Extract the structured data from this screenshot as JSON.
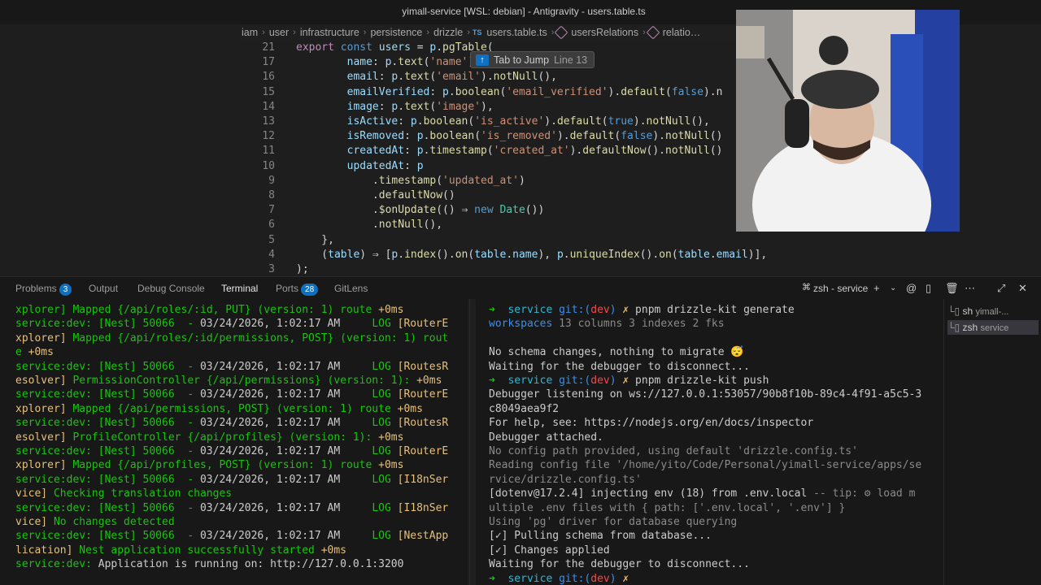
{
  "window": {
    "title": "yimall-service [WSL: debian] - Antigravity - users.table.ts"
  },
  "breadcrumb": [
    "iam",
    "user",
    "infrastructure",
    "persistence",
    "drizzle",
    "users.table.ts",
    "usersRelations",
    "relatio…"
  ],
  "breadcrumb_file_badge": "TS",
  "tooltip": {
    "text": "Tab to Jump",
    "sub": "Line 13"
  },
  "editor": {
    "lines": [
      {
        "n": "21",
        "segs": [
          [
            "kw",
            "export "
          ],
          [
            "kw2",
            "const "
          ],
          [
            "var",
            "users"
          ],
          [
            "w",
            " = "
          ],
          [
            "var",
            "p"
          ],
          [
            "w",
            "."
          ],
          [
            "fn",
            "pgTable"
          ],
          [
            "w",
            "("
          ]
        ]
      },
      {
        "n": "17",
        "segs": [
          [
            "w",
            "        "
          ],
          [
            "var",
            "name"
          ],
          [
            "w",
            ": "
          ],
          [
            "var",
            "p"
          ],
          [
            "w",
            "."
          ],
          [
            "fn",
            "text"
          ],
          [
            "w",
            "("
          ],
          [
            "str",
            "'name'"
          ],
          [
            "w",
            ")"
          ]
        ]
      },
      {
        "n": "16",
        "segs": [
          [
            "w",
            "        "
          ],
          [
            "var",
            "email"
          ],
          [
            "w",
            ": "
          ],
          [
            "var",
            "p"
          ],
          [
            "w",
            "."
          ],
          [
            "fn",
            "text"
          ],
          [
            "w",
            "("
          ],
          [
            "str",
            "'email'"
          ],
          [
            "w",
            ")."
          ],
          [
            "fn",
            "notNull"
          ],
          [
            "w",
            "(),"
          ]
        ]
      },
      {
        "n": "15",
        "segs": [
          [
            "w",
            "        "
          ],
          [
            "var",
            "emailVerified"
          ],
          [
            "w",
            ": "
          ],
          [
            "var",
            "p"
          ],
          [
            "w",
            "."
          ],
          [
            "fn",
            "boolean"
          ],
          [
            "w",
            "("
          ],
          [
            "str",
            "'email_verified'"
          ],
          [
            "w",
            ")."
          ],
          [
            "fn",
            "default"
          ],
          [
            "w",
            "("
          ],
          [
            "kw2",
            "false"
          ],
          [
            "w",
            ").n"
          ]
        ]
      },
      {
        "n": "14",
        "segs": [
          [
            "w",
            "        "
          ],
          [
            "var",
            "image"
          ],
          [
            "w",
            ": "
          ],
          [
            "var",
            "p"
          ],
          [
            "w",
            "."
          ],
          [
            "fn",
            "text"
          ],
          [
            "w",
            "("
          ],
          [
            "str",
            "'image'"
          ],
          [
            "w",
            "),"
          ]
        ]
      },
      {
        "n": "13",
        "segs": [
          [
            "w",
            "        "
          ],
          [
            "var",
            "isActive"
          ],
          [
            "w",
            ": "
          ],
          [
            "var",
            "p"
          ],
          [
            "w",
            "."
          ],
          [
            "fn",
            "boolean"
          ],
          [
            "w",
            "("
          ],
          [
            "str",
            "'is_active'"
          ],
          [
            "w",
            ")."
          ],
          [
            "fn",
            "default"
          ],
          [
            "w",
            "("
          ],
          [
            "kw2",
            "true"
          ],
          [
            "w",
            ")."
          ],
          [
            "fn",
            "notNull"
          ],
          [
            "w",
            "(),"
          ]
        ]
      },
      {
        "n": "12",
        "segs": [
          [
            "w",
            "        "
          ],
          [
            "var",
            "isRemoved"
          ],
          [
            "w",
            ": "
          ],
          [
            "var",
            "p"
          ],
          [
            "w",
            "."
          ],
          [
            "fn",
            "boolean"
          ],
          [
            "w",
            "("
          ],
          [
            "str",
            "'is_removed'"
          ],
          [
            "w",
            ")."
          ],
          [
            "fn",
            "default"
          ],
          [
            "w",
            "("
          ],
          [
            "kw2",
            "false"
          ],
          [
            "w",
            ")."
          ],
          [
            "fn",
            "notNull"
          ],
          [
            "w",
            "()"
          ]
        ]
      },
      {
        "n": "11",
        "segs": [
          [
            "w",
            "        "
          ],
          [
            "var",
            "createdAt"
          ],
          [
            "w",
            ": "
          ],
          [
            "var",
            "p"
          ],
          [
            "w",
            "."
          ],
          [
            "fn",
            "timestamp"
          ],
          [
            "w",
            "("
          ],
          [
            "str",
            "'created_at'"
          ],
          [
            "w",
            ")."
          ],
          [
            "fn",
            "defaultNow"
          ],
          [
            "w",
            "()."
          ],
          [
            "fn",
            "notNull"
          ],
          [
            "w",
            "()"
          ]
        ]
      },
      {
        "n": "10",
        "segs": [
          [
            "w",
            "        "
          ],
          [
            "var",
            "updatedAt"
          ],
          [
            "w",
            ": "
          ],
          [
            "var",
            "p"
          ]
        ]
      },
      {
        "n": "9",
        "segs": [
          [
            "w",
            "            ."
          ],
          [
            "fn",
            "timestamp"
          ],
          [
            "w",
            "("
          ],
          [
            "str",
            "'updated_at'"
          ],
          [
            "w",
            ")"
          ]
        ]
      },
      {
        "n": "8",
        "segs": [
          [
            "w",
            "            ."
          ],
          [
            "fn",
            "defaultNow"
          ],
          [
            "w",
            "()"
          ]
        ]
      },
      {
        "n": "7",
        "segs": [
          [
            "w",
            "            ."
          ],
          [
            "fn",
            "$onUpdate"
          ],
          [
            "w",
            "(() ⇒ "
          ],
          [
            "kw2",
            "new "
          ],
          [
            "cls",
            "Date"
          ],
          [
            "w",
            "())"
          ]
        ]
      },
      {
        "n": "6",
        "segs": [
          [
            "w",
            "            ."
          ],
          [
            "fn",
            "notNull"
          ],
          [
            "w",
            "(),"
          ]
        ]
      },
      {
        "n": "5",
        "segs": [
          [
            "w",
            "    },"
          ]
        ]
      },
      {
        "n": "4",
        "segs": [
          [
            "w",
            "    ("
          ],
          [
            "var",
            "table"
          ],
          [
            "w",
            ") ⇒ ["
          ],
          [
            "var",
            "p"
          ],
          [
            "w",
            "."
          ],
          [
            "fn",
            "index"
          ],
          [
            "w",
            "()."
          ],
          [
            "fn",
            "on"
          ],
          [
            "w",
            "("
          ],
          [
            "var",
            "table"
          ],
          [
            "w",
            "."
          ],
          [
            "var",
            "name"
          ],
          [
            "w",
            "), "
          ],
          [
            "var",
            "p"
          ],
          [
            "w",
            "."
          ],
          [
            "fn",
            "uniqueIndex"
          ],
          [
            "w",
            "()."
          ],
          [
            "fn",
            "on"
          ],
          [
            "w",
            "("
          ],
          [
            "var",
            "table"
          ],
          [
            "w",
            "."
          ],
          [
            "var",
            "email"
          ],
          [
            "w",
            ")],"
          ]
        ]
      },
      {
        "n": "3",
        "segs": [
          [
            "w",
            ");"
          ]
        ]
      }
    ]
  },
  "panel": {
    "tabs": [
      {
        "label": "Problems",
        "badge": "3"
      },
      {
        "label": "Output"
      },
      {
        "label": "Debug Console"
      },
      {
        "label": "Terminal",
        "active": true
      },
      {
        "label": "Ports",
        "badge": "28"
      },
      {
        "label": "GitLens"
      }
    ],
    "terminal_name": "zsh - service"
  },
  "terminal_left": [
    [
      [
        "g",
        "xplorer] "
      ],
      [
        "g",
        "Mapped {/api/roles/:id, PUT} (version: 1) route "
      ],
      [
        "y",
        "+0ms"
      ]
    ],
    [
      [
        "g",
        "service:dev: [Nest] 50066  - "
      ],
      [
        "w",
        "03/24/2026, 1:02:17 AM     "
      ],
      [
        "g",
        "LOG "
      ],
      [
        "y",
        "[RouterE"
      ]
    ],
    [
      [
        "y",
        "xplorer] "
      ],
      [
        "g",
        "Mapped {/api/roles/:id/permissions, POST} (version: 1) rout"
      ]
    ],
    [
      [
        "g",
        "e "
      ],
      [
        "y",
        "+0ms"
      ]
    ],
    [
      [
        "g",
        "service:dev: [Nest] 50066  - "
      ],
      [
        "w",
        "03/24/2026, 1:02:17 AM     "
      ],
      [
        "g",
        "LOG "
      ],
      [
        "y",
        "[RoutesR"
      ]
    ],
    [
      [
        "y",
        "esolver] "
      ],
      [
        "g",
        "PermissionController {/api/permissions} (version: 1): "
      ],
      [
        "y",
        "+0ms"
      ]
    ],
    [
      [
        "g",
        "service:dev: [Nest] 50066  - "
      ],
      [
        "w",
        "03/24/2026, 1:02:17 AM     "
      ],
      [
        "g",
        "LOG "
      ],
      [
        "y",
        "[RouterE"
      ]
    ],
    [
      [
        "y",
        "xplorer] "
      ],
      [
        "g",
        "Mapped {/api/permissions, POST} (version: 1) route "
      ],
      [
        "y",
        "+0ms"
      ]
    ],
    [
      [
        "g",
        "service:dev: [Nest] 50066  - "
      ],
      [
        "w",
        "03/24/2026, 1:02:17 AM     "
      ],
      [
        "g",
        "LOG "
      ],
      [
        "y",
        "[RoutesR"
      ]
    ],
    [
      [
        "y",
        "esolver] "
      ],
      [
        "g",
        "ProfileController {/api/profiles} (version: 1): "
      ],
      [
        "y",
        "+0ms"
      ]
    ],
    [
      [
        "g",
        "service:dev: [Nest] 50066  - "
      ],
      [
        "w",
        "03/24/2026, 1:02:17 AM     "
      ],
      [
        "g",
        "LOG "
      ],
      [
        "y",
        "[RouterE"
      ]
    ],
    [
      [
        "y",
        "xplorer] "
      ],
      [
        "g",
        "Mapped {/api/profiles, POST} (version: 1) route "
      ],
      [
        "y",
        "+0ms"
      ]
    ],
    [
      [
        "g",
        "service:dev: [Nest] 50066  - "
      ],
      [
        "w",
        "03/24/2026, 1:02:17 AM     "
      ],
      [
        "g",
        "LOG "
      ],
      [
        "y",
        "[I18nSer"
      ]
    ],
    [
      [
        "y",
        "vice] "
      ],
      [
        "g",
        "Checking translation changes"
      ]
    ],
    [
      [
        "g",
        "service:dev: [Nest] 50066  - "
      ],
      [
        "w",
        "03/24/2026, 1:02:17 AM     "
      ],
      [
        "g",
        "LOG "
      ],
      [
        "y",
        "[I18nSer"
      ]
    ],
    [
      [
        "y",
        "vice] "
      ],
      [
        "g",
        "No changes detected"
      ]
    ],
    [
      [
        "g",
        "service:dev: [Nest] 50066  - "
      ],
      [
        "w",
        "03/24/2026, 1:02:17 AM     "
      ],
      [
        "g",
        "LOG "
      ],
      [
        "y",
        "[NestApp"
      ]
    ],
    [
      [
        "y",
        "lication] "
      ],
      [
        "g",
        "Nest application successfully started "
      ],
      [
        "y",
        "+0ms"
      ]
    ],
    [
      [
        "g",
        "service:dev: "
      ],
      [
        "w",
        "Application is running on: http://127.0.0.1:3200"
      ]
    ],
    [
      [
        "w",
        ""
      ]
    ]
  ],
  "terminal_right": [
    [
      [
        "g",
        "➜  "
      ],
      [
        "cy",
        "service "
      ],
      [
        "b",
        "git:("
      ],
      [
        "tr",
        "dev"
      ],
      [
        "b",
        ") "
      ],
      [
        "y",
        "✗ "
      ],
      [
        "w",
        "pnpm drizzle-kit generate"
      ]
    ],
    [
      [
        "b",
        "workspaces "
      ],
      [
        "gray",
        "13 columns 3 indexes 2 fks"
      ]
    ],
    [
      [
        "w",
        ""
      ]
    ],
    [
      [
        "w",
        "No schema changes, nothing to migrate 😴"
      ]
    ],
    [
      [
        "w",
        "Waiting for the debugger to disconnect..."
      ]
    ],
    [
      [
        "g",
        "➜  "
      ],
      [
        "cy",
        "service "
      ],
      [
        "b",
        "git:("
      ],
      [
        "tr",
        "dev"
      ],
      [
        "b",
        ") "
      ],
      [
        "y",
        "✗ "
      ],
      [
        "w",
        "pnpm drizzle-kit push"
      ]
    ],
    [
      [
        "w",
        "Debugger listening on ws://127.0.0.1:53057/90b8f10b-89c4-4f91-a5c5-3"
      ]
    ],
    [
      [
        "w",
        "c8049aea9f2"
      ]
    ],
    [
      [
        "w",
        "For help, see: https://nodejs.org/en/docs/inspector"
      ]
    ],
    [
      [
        "w",
        "Debugger attached."
      ]
    ],
    [
      [
        "gray",
        "No config path provided, using default 'drizzle.config.ts'"
      ]
    ],
    [
      [
        "gray",
        "Reading config file '/home/yito/Code/Personal/yimall-service/apps/se"
      ]
    ],
    [
      [
        "gray",
        "rvice/drizzle.config.ts'"
      ]
    ],
    [
      [
        "w",
        "[dotenv@17.2.4] injecting env (18) from .env.local "
      ],
      [
        "gray",
        "-- tip: ⚙ load m"
      ]
    ],
    [
      [
        "gray",
        "ultiple .env files with { path: ['.env.local', '.env'] }"
      ]
    ],
    [
      [
        "gray",
        "Using 'pg' driver for database querying"
      ]
    ],
    [
      [
        "w",
        "[✓] Pulling schema from database..."
      ]
    ],
    [
      [
        "w",
        "[✓] Changes applied"
      ]
    ],
    [
      [
        "w",
        "Waiting for the debugger to disconnect..."
      ]
    ],
    [
      [
        "g",
        "➜  "
      ],
      [
        "cy",
        "service "
      ],
      [
        "b",
        "git:("
      ],
      [
        "tr",
        "dev"
      ],
      [
        "b",
        ") "
      ],
      [
        "y",
        "✗"
      ]
    ]
  ],
  "terminal_list": [
    {
      "shell": "sh",
      "label": "yimall-..."
    },
    {
      "shell": "zsh",
      "label": "service",
      "selected": true
    }
  ]
}
